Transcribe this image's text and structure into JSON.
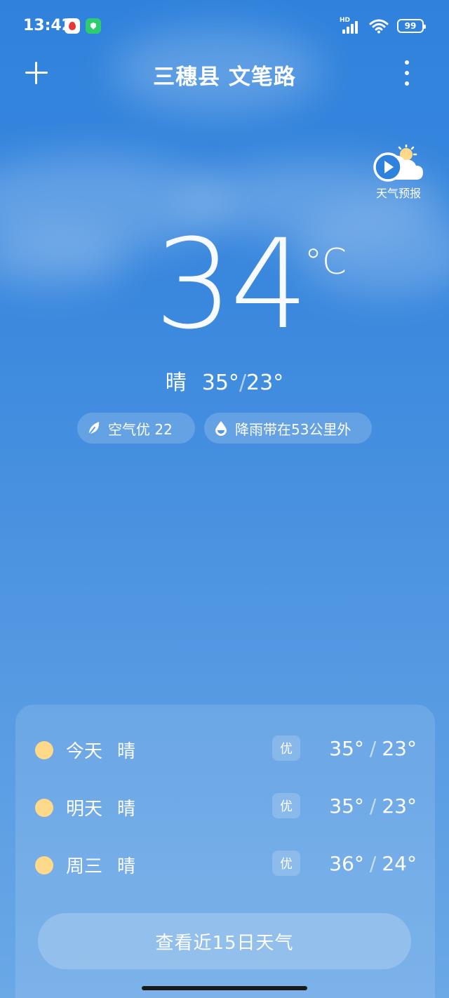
{
  "status_bar": {
    "time": "13:42",
    "network_label": "HD",
    "battery": "99",
    "icons": [
      "map-pin-app-icon",
      "shield-app-icon",
      "signal-icon",
      "wifi-icon",
      "battery-icon"
    ]
  },
  "header": {
    "title": "三穗县 文笔路"
  },
  "video_forecast": {
    "label": "天气预报"
  },
  "current": {
    "temperature": "34",
    "unit": "°C",
    "condition": "晴",
    "high": "35°",
    "low": "23°",
    "separator": "/"
  },
  "chips": {
    "air_quality": "空气优 22",
    "rain": "降雨带在53公里外"
  },
  "forecast": [
    {
      "day": "今天",
      "condition": "晴",
      "aqi": "优",
      "high": "35°",
      "low": "23°"
    },
    {
      "day": "明天",
      "condition": "晴",
      "aqi": "优",
      "high": "35°",
      "low": "23°"
    },
    {
      "day": "周三",
      "condition": "晴",
      "aqi": "优",
      "high": "36°",
      "low": "24°"
    }
  ],
  "forecast_separator": "/",
  "more_button": "查看近15日天气",
  "colors": {
    "sky_top": "#2f82dc",
    "sky_bottom": "#6aa8e6",
    "sun": "#ffd98a"
  }
}
